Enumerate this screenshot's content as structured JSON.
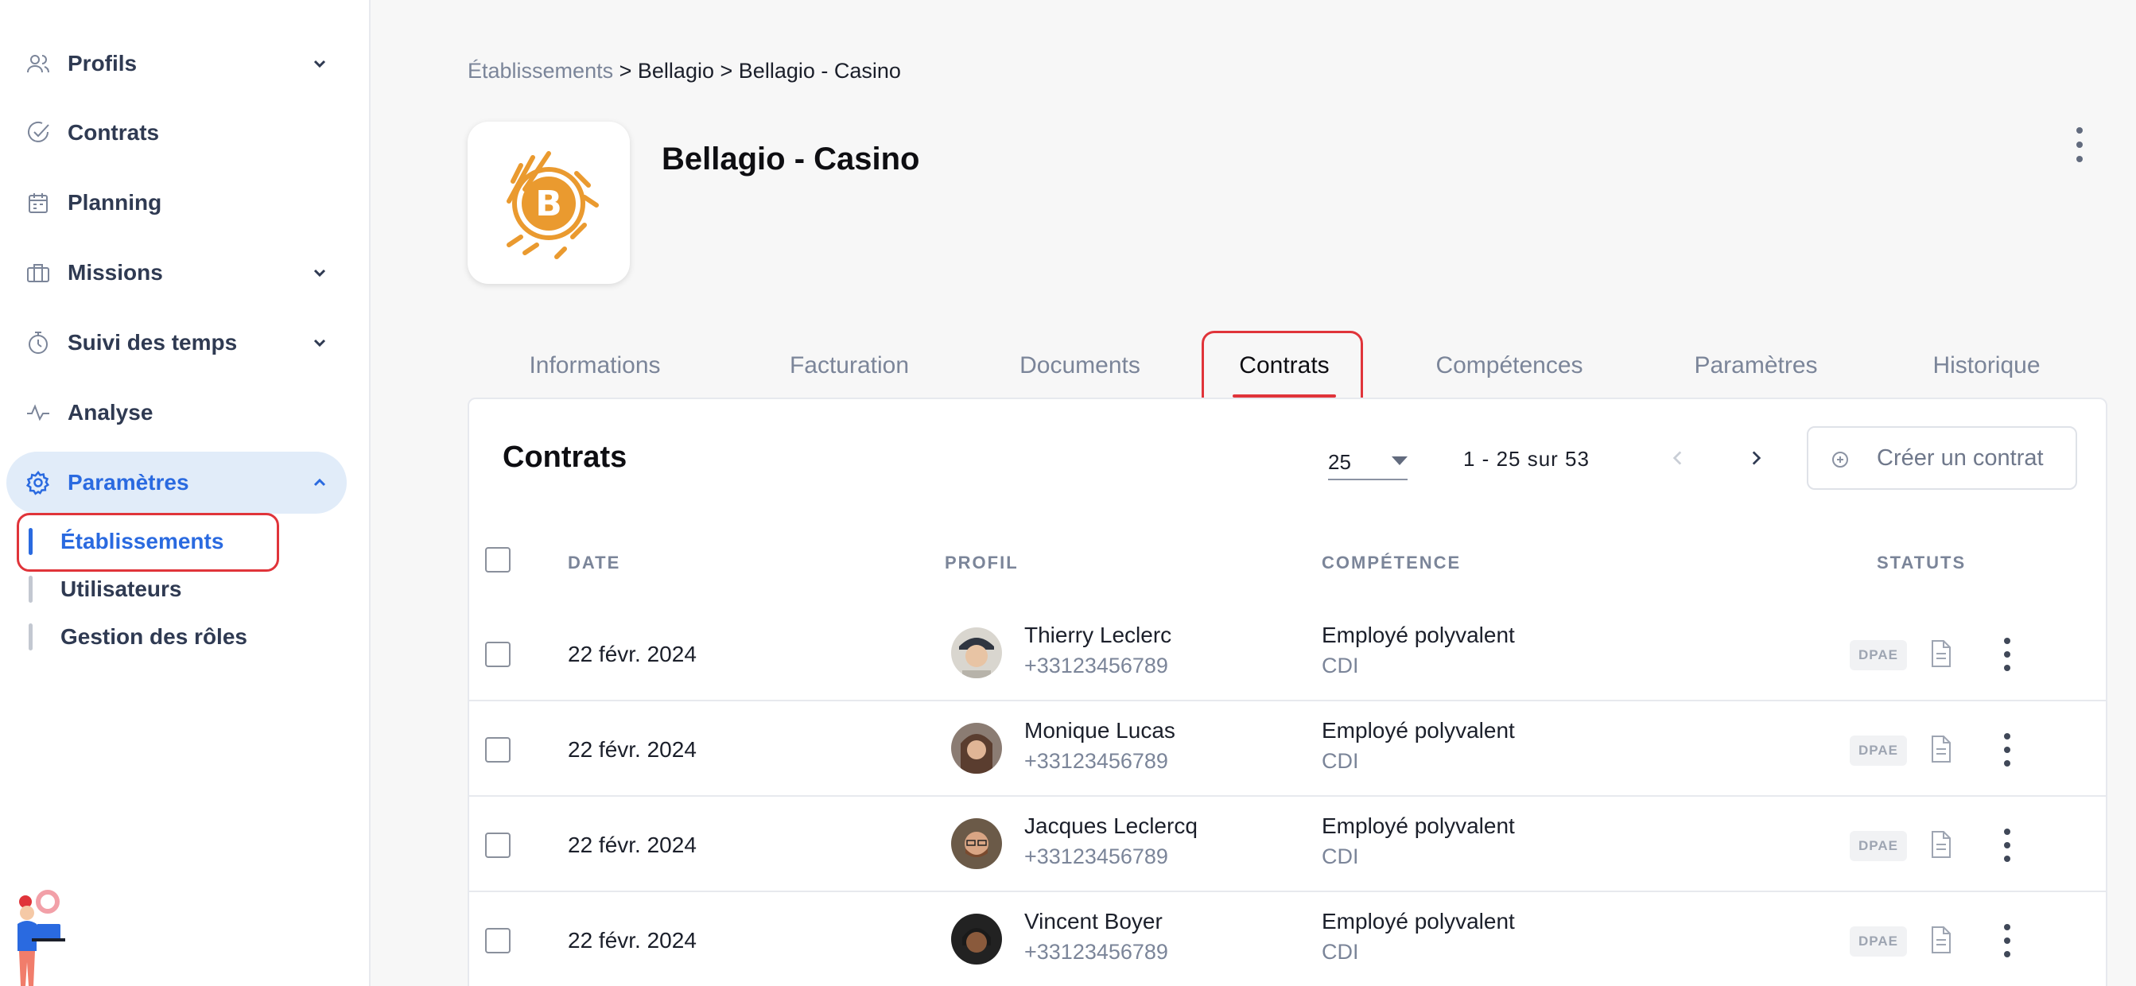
{
  "sidebar": {
    "items": [
      {
        "label": "Profils",
        "icon": "users-icon",
        "has_chevron": true
      },
      {
        "label": "Contrats",
        "icon": "check-circle-icon",
        "has_chevron": false
      },
      {
        "label": "Planning",
        "icon": "calendar-icon",
        "has_chevron": false
      },
      {
        "label": "Missions",
        "icon": "briefcase-icon",
        "has_chevron": true
      },
      {
        "label": "Suivi des temps",
        "icon": "stopwatch-icon",
        "has_chevron": true
      },
      {
        "label": "Analyse",
        "icon": "activity-icon",
        "has_chevron": false
      },
      {
        "label": "Paramètres",
        "icon": "gear-icon",
        "has_chevron": true,
        "active": true
      }
    ],
    "sub_items": [
      {
        "label": "Établissements",
        "active": true
      },
      {
        "label": "Utilisateurs"
      },
      {
        "label": "Gestion des rôles"
      }
    ]
  },
  "breadcrumb": {
    "root": "Établissements",
    "sep": ">",
    "level1": "Bellagio",
    "level2": "Bellagio - Casino"
  },
  "header": {
    "title": "Bellagio - Casino",
    "logo_icon": "bitcoin-logo-icon",
    "brand_color": "#ea9a2f"
  },
  "tabs": [
    {
      "label": "Informations"
    },
    {
      "label": "Facturation"
    },
    {
      "label": "Documents"
    },
    {
      "label": "Contrats",
      "active": true
    },
    {
      "label": "Compétences"
    },
    {
      "label": "Paramètres"
    },
    {
      "label": "Historique"
    }
  ],
  "contracts": {
    "title": "Contrats",
    "per_page": "25",
    "range": "1 - 25 sur 53",
    "create_label": "Créer un contrat",
    "columns": {
      "date": "DATE",
      "profile": "PROFIL",
      "skill": "COMPÉTENCE",
      "status": "STATUTS"
    },
    "rows": [
      {
        "date": "22 févr. 2024",
        "name": "Thierry Leclerc",
        "phone": "+33123456789",
        "skill": "Employé polyvalent",
        "contract_type": "CDI",
        "badge": "DPAE"
      },
      {
        "date": "22 févr. 2024",
        "name": "Monique Lucas",
        "phone": "+33123456789",
        "skill": "Employé polyvalent",
        "contract_type": "CDI",
        "badge": "DPAE"
      },
      {
        "date": "22 févr. 2024",
        "name": "Jacques Leclercq",
        "phone": "+33123456789",
        "skill": "Employé polyvalent",
        "contract_type": "CDI",
        "badge": "DPAE"
      },
      {
        "date": "22 févr. 2024",
        "name": "Vincent Boyer",
        "phone": "+33123456789",
        "skill": "Employé polyvalent",
        "contract_type": "CDI",
        "badge": "DPAE"
      }
    ]
  },
  "colors": {
    "accent": "#2a6ae0",
    "active_tab_underline": "#e0343a",
    "highlight": "#e0343a"
  }
}
